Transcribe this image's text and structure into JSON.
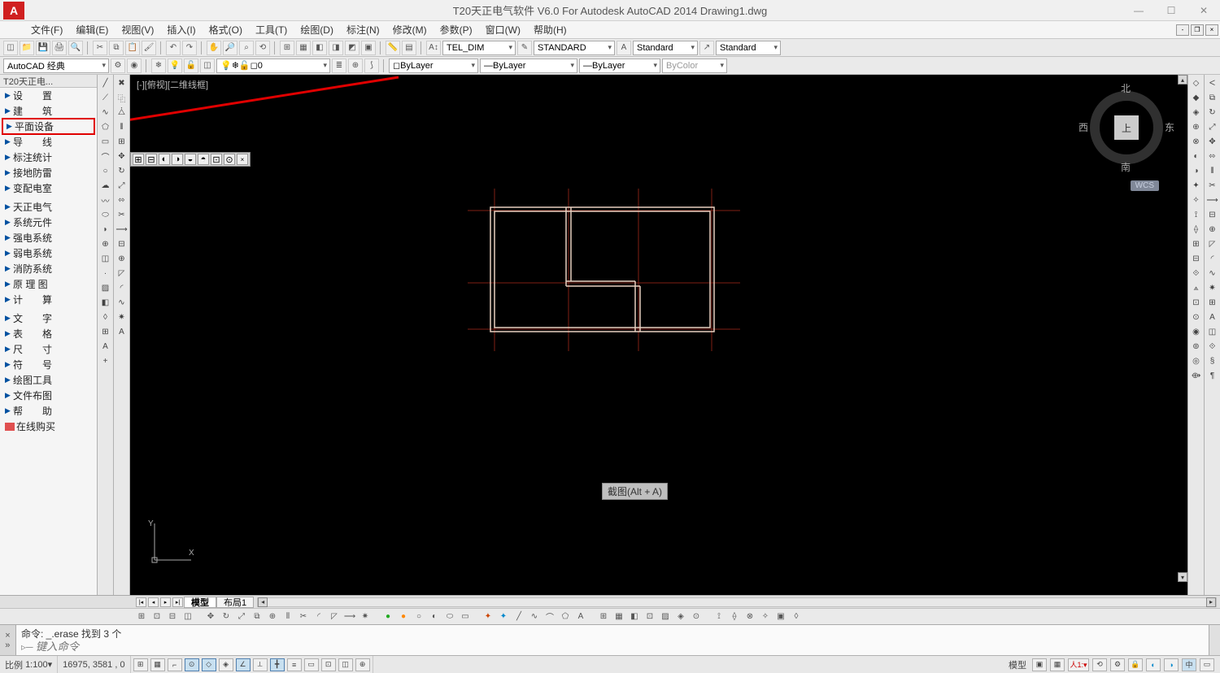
{
  "title": "T20天正电气软件 V6.0 For Autodesk AutoCAD 2014   Drawing1.dwg",
  "menu": [
    "文件(F)",
    "编辑(E)",
    "视图(V)",
    "插入(I)",
    "格式(O)",
    "工具(T)",
    "绘图(D)",
    "标注(N)",
    "修改(M)",
    "参数(P)",
    "窗口(W)",
    "帮助(H)"
  ],
  "workspace": "AutoCAD 经典",
  "style_selects": {
    "dim": "TEL_DIM",
    "text": "STANDARD",
    "table": "Standard",
    "ml": "Standard"
  },
  "layer_row": {
    "layer_dropdown": "0",
    "linetype": "ByLayer",
    "lineweight": "ByLayer",
    "color": "ByLayer",
    "plotstyle": "ByColor"
  },
  "sidepanel": {
    "title": "T20天正电...",
    "groups": [
      [
        "设　　置",
        "建　　筑",
        "平面设备",
        "导　　线",
        "标注统计",
        "接地防雷",
        "变配电室"
      ],
      [
        "天正电气",
        "系统元件",
        "强电系统",
        "弱电系统",
        "消防系统",
        "原 理 图",
        "计　　算"
      ],
      [
        "文　　字",
        "表　　格",
        "尺　　寸",
        "符　　号",
        "绘图工具",
        "文件布图",
        "帮　　助"
      ]
    ],
    "buy": "在线购买",
    "highlight_index": 2
  },
  "viewport": {
    "label": "[-][俯视][二维线框]",
    "cube_face": "上",
    "dirs": {
      "n": "北",
      "s": "南",
      "e": "东",
      "w": "西"
    },
    "wcs": "WCS"
  },
  "tooltip": "截图(Alt + A)",
  "tabs": {
    "model": "模型",
    "layout": "布局1"
  },
  "command": {
    "history": "命令: _.erase 找到 3 个",
    "prompt_label": "",
    "placeholder": "键入命令"
  },
  "status": {
    "scale_label": "比例",
    "scale": "1:100",
    "coords": "16975, 3581 , 0",
    "right_model": "模型",
    "ime": "中"
  }
}
